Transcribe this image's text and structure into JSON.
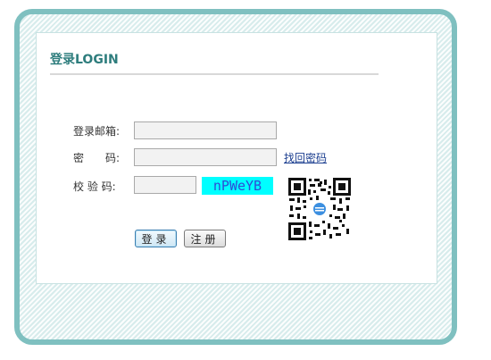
{
  "login": {
    "title": "登录LOGIN",
    "email_label": "登录邮箱:",
    "email_value": "",
    "password_label": "密　　码:",
    "password_value": "",
    "forgot_password_link": "找回密码",
    "captcha_label": "校 验 码:",
    "captcha_value": "",
    "captcha_text": "nPWeYB",
    "login_button": "登录",
    "register_button": "注册"
  },
  "colors": {
    "frame_border": "#7fc0c0",
    "title": "#2e7d7d",
    "captcha_background": "#00ffff",
    "captcha_text": "#2e4bd6",
    "link": "#1a3d8f"
  },
  "icons": {
    "qr_code": "qr-code-icon"
  }
}
